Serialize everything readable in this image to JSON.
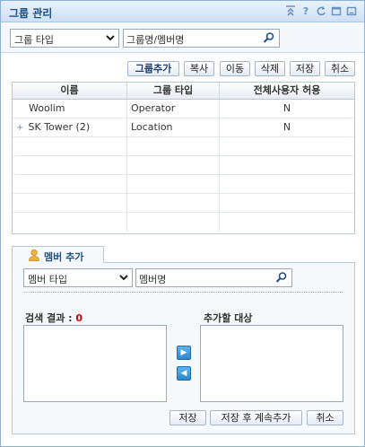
{
  "window": {
    "title": "그룹 관리",
    "icons": [
      "collapse-icon",
      "help-icon",
      "refresh-icon",
      "restore-icon",
      "close-icon"
    ]
  },
  "group_filter": {
    "type_select": "그룹 타입",
    "search_value": "그룹명/멤버명"
  },
  "toolbar": {
    "add_group": "그룹추가",
    "copy": "복사",
    "move": "이동",
    "delete": "삭제",
    "save": "저장",
    "cancel": "취소"
  },
  "group_table": {
    "columns": [
      "이름",
      "그룹 타입",
      "전체사용자 허용"
    ],
    "rows": [
      {
        "name": "Woolim",
        "type": "Operator",
        "allow_all": "N",
        "expandable": false
      },
      {
        "name": "SK Tower (2)",
        "type": "Location",
        "allow_all": "N",
        "expandable": true
      }
    ],
    "empty_rows": 5
  },
  "member_add": {
    "tab_label": "멤버 추가",
    "type_select": "멤버 타입",
    "search_value": "멤버명",
    "result_label": "검색 결과 :",
    "result_count": "0",
    "target_label": "추가할 대상",
    "save": "저장",
    "save_continue": "저장 후 계속추가",
    "cancel": "취소"
  },
  "colors": {
    "accent": "#1f4f8a",
    "count": "#d00000",
    "arrow_button": "#2b86cd"
  }
}
